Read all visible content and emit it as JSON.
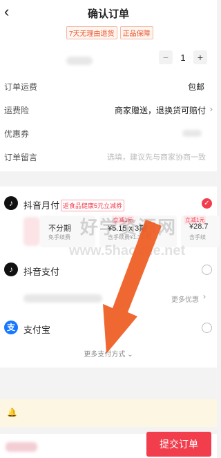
{
  "header": {
    "title": "确认订单",
    "back_icon": "chevron-left-icon"
  },
  "tags": [
    "7天无理由退货",
    "正品保障"
  ],
  "product": {
    "quantity": "1",
    "minus": "−",
    "plus": "+"
  },
  "rows": {
    "shipping": {
      "label": "订单运费",
      "value": "包邮"
    },
    "insurance": {
      "label": "运费险",
      "value": "商家赠送，退换货可赔付"
    },
    "coupon": {
      "label": "优惠券"
    },
    "note": {
      "label": "订单留言",
      "placeholder": "选填，建议先与商家协商一致"
    }
  },
  "payment": {
    "yuefu": {
      "name": "抖音月付",
      "promo": "返食品健康5元立减券",
      "installments": [
        {
          "title": "不分期",
          "sub": "免手续费"
        },
        {
          "title": "¥5.15 x 3期",
          "sub": "含手续费¥1.32/期",
          "mini": "立减1元"
        },
        {
          "title": "¥28.7",
          "sub": "含手续",
          "mini": "立减1元"
        }
      ]
    },
    "douyin_pay": {
      "name": "抖音支付",
      "more": "更多优惠"
    },
    "alipay": {
      "name": "支付宝"
    },
    "more_methods": "更多支付方式"
  },
  "bottom": {
    "submit": "提交订单"
  },
  "watermark": {
    "line1": "好学资源网",
    "line2": "www.5haoxue.net"
  },
  "colors": {
    "accent": "#f23d4d",
    "arrow": "#ef5b1f",
    "alipay": "#1677ff"
  }
}
